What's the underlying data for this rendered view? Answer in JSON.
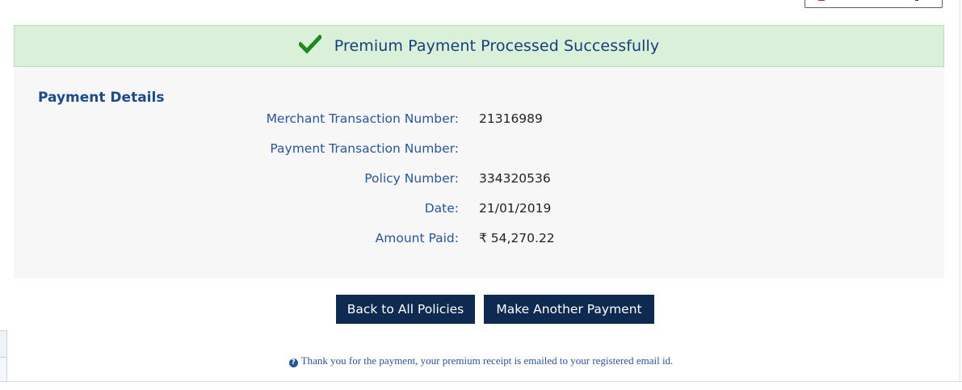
{
  "banner": {
    "message": "Premium Payment Processed Successfully",
    "icon": "check-icon",
    "color": "#1e8a1e"
  },
  "details": {
    "title": "Payment Details",
    "rows": [
      {
        "label": "Merchant Transaction Number:",
        "value": "21316989"
      },
      {
        "label": "Payment Transaction Number:",
        "value": ""
      },
      {
        "label": "Policy Number:",
        "value": "334320536"
      },
      {
        "label": "Date:",
        "value": "21/01/2019"
      },
      {
        "label": "Amount Paid:",
        "value": "₹ 54,270.22"
      }
    ]
  },
  "actions": {
    "back_label": "Back to All Policies",
    "another_label": "Make Another Payment"
  },
  "footer": {
    "icon": "question-circle-icon",
    "note": "Thank you for the payment, your premium receipt is emailed to your registered email id."
  },
  "colors": {
    "accent": "#0e2a50",
    "success_bg": "#daf0d9",
    "label_blue": "#2a5596"
  }
}
